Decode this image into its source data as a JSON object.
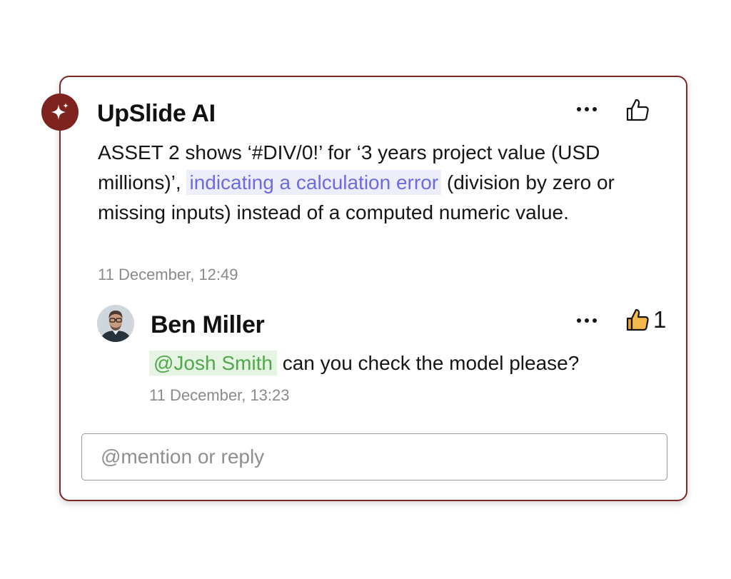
{
  "comment": {
    "author": "UpSlide AI",
    "icon": "sparkle-icon",
    "badge_color": "#7e231d",
    "text_before": "ASSET 2 shows ‘#DIV/0!’ for ‘3 years project value (USD millions)’,",
    "text_highlight": "indicating a calculation error",
    "text_after": "(division by zero or missing inputs) instead of a computed numeric value.",
    "timestamp": "11 December, 12:49"
  },
  "reply": {
    "author": "Ben Miller",
    "mention": "@Josh Smith",
    "text": "can you check the model please?",
    "timestamp": "11 December, 13:23",
    "like_count": "1",
    "like_color": "#f2b84b"
  },
  "input": {
    "placeholder": "@mention or reply",
    "value": ""
  },
  "colors": {
    "card_border": "#7a2a22",
    "ai_highlight_text": "#6b6be0",
    "ai_highlight_bg": "#eeeefb",
    "mention_text": "#4fa84a",
    "mention_bg": "#e6f4e4"
  }
}
